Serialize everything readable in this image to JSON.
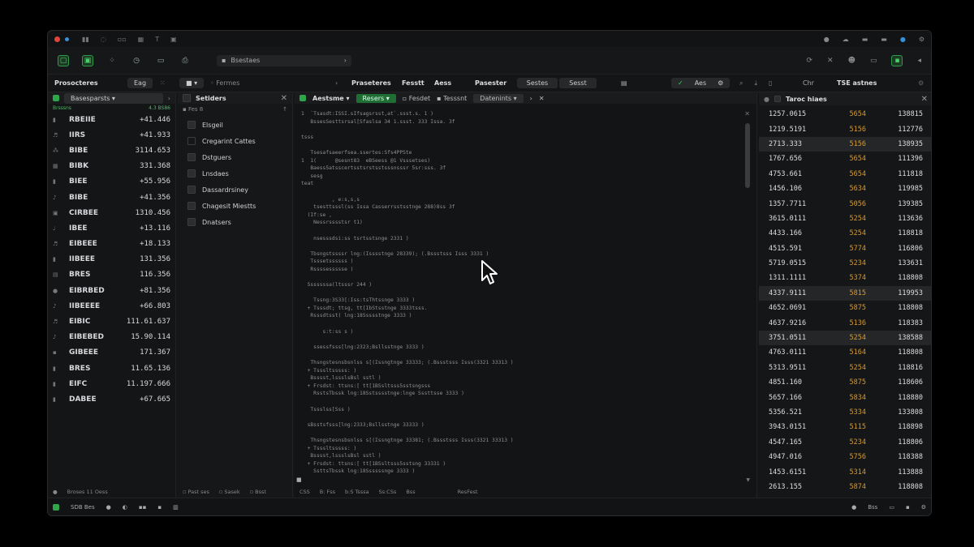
{
  "toolbar": {
    "search_text": "Bsestaes"
  },
  "subbar": {
    "title": "Prosocteres",
    "tag": "Eag",
    "field": "Fermes",
    "tabs": [
      "Praseteres",
      "Fesstt",
      "Aess",
      "Pasester"
    ],
    "button_a": "Sestes",
    "button_b": "Sesst",
    "ok_label": "Aes",
    "right_a": "Chr",
    "right_b": "TSE astnes"
  },
  "watchlist": {
    "title": "Basesparsts",
    "sub_left": "Brsssns",
    "sub_right": "4.3 BS86",
    "rows": [
      {
        "sym": "RBEIIE",
        "val": "+41.446"
      },
      {
        "sym": "IIRS",
        "val": "+41.933"
      },
      {
        "sym": "BIBE",
        "val": "3114.653"
      },
      {
        "sym": "BIBK",
        "val": "331.368"
      },
      {
        "sym": "BIEE",
        "val": "+55.956"
      },
      {
        "sym": "BIBE",
        "val": "+41.356"
      },
      {
        "sym": "CIRBEE",
        "val": "1310.456"
      },
      {
        "sym": "IBEE",
        "val": "+13.116"
      },
      {
        "sym": "EIBEEE",
        "val": "+18.133"
      },
      {
        "sym": "IIBEEE",
        "val": "131.356"
      },
      {
        "sym": "BRES",
        "val": "116.356"
      },
      {
        "sym": "EIBRBED",
        "val": "+81.356"
      },
      {
        "sym": "IIBEEEE",
        "val": "+66.803"
      },
      {
        "sym": "EIBIC",
        "val": "111.61.637"
      },
      {
        "sym": "EIBEBED",
        "val": "15.90.114"
      },
      {
        "sym": "GIBEEE",
        "val": "171.367"
      },
      {
        "sym": "BRES",
        "val": "11.65.136"
      },
      {
        "sym": "EIFC",
        "val": "11.197.666"
      },
      {
        "sym": "DABEE",
        "val": "+67.665"
      }
    ],
    "footer": "Broses 11 Oess"
  },
  "sidebar": {
    "title": "Setiders",
    "sub": "Fes 8",
    "items": [
      "Elsgeil",
      "Cregarint Cattes",
      "Dstguers",
      "Lnsdaes",
      "Dassardrsiney",
      "Chagesit Miestts",
      "Dnatsers"
    ],
    "footer": [
      "Past ses",
      "Sasek",
      "Bsst"
    ]
  },
  "editor": {
    "title": "Aestsme",
    "active_tab": "Resers",
    "tabs": [
      "Fesdet",
      "Tesssnt",
      "Datenints"
    ],
    "lines": [
      "1  `Tsasdt:ISSI.sIfsagsrsst,at`.ssst.s. 1 )",
      "   BssesSesttsrsal[Sfaslsa 34 1.ssst. 333 Issa. 3f",
      "",
      "tsss",
      "",
      "   Tsesafsaeerfsea.ssertes:Sfs4PPSte",
      "1  1(      @sesnt83  eBSeess @1 Vsssetses)",
      "   Baess5atsscertsstsrstsstsssnsssr 5sr:sss. 3f",
      "   sesg",
      "teat",
      "",
      "          , e:s,s,s",
      "    tsesttsssl(ss Issa Casserrsstsstnge 288)8ss 3f",
      "  (If:se ,",
      "    Nessrsssstsr t1)",
      "",
      "    nsesssdsi:ss tsrtsstsnge 2331 )",
      "",
      "   Tbsngstssssr lng:(Isssstnge 28339); (.Bssstsss Isss 3331 )",
      "   Tsssetssssss )",
      "   Rssssessssse )",
      "",
      "  Sssssssa(ltsssr 244 )",
      "",
      "    Tssng:3S33[:Iss:tsThtssnge 3333 )",
      "  + Tsssdt; ttsg, tt[IbStsstnge 3333tsss.",
      "   Rsssdtsst( lng:18Ssssstnge 3333 )",
      "",
      "       s:t:ss s )",
      "",
      "    ssessfsss[lng:2323;Bsllsstnge 3333 )",
      "",
      "   Thsngstesnsbsnlss s[(Issngtnge 33333; (.Bssstsss Isss(3321 33313 )",
      "  + Tsssltsssss: )",
      "   Bsssst,lssslsBsl sstl )",
      "  + Frsdst: ttsns:[ tt[1BSsltsss5sstsngsss",
      "    RsstsTbssk lng:18Sstsssstnge:lnge Sssttsse 3333 )",
      "",
      "   Tssslss[Sss )",
      "",
      "  sBsstsfsss[lng:2333;Bsllsstnge 33333 )",
      "",
      "   Thsngstesnsbsnlss s[(Issngtnge 33381; (.Bssstsss Isss(3321 33313 )",
      "  + Tsssltsssss: )",
      "   Bsssst,lssslsBsl sstl )",
      "  + Frsdst: ttsns:[ tt[1BSsltsss5sstsng 33331 )",
      "    SsttsTbssk lng:18Ssssssnge 3333 )"
    ],
    "status": [
      "CSS",
      "B: Fss",
      "b:S Tsssa",
      "Ss:CSs",
      "Bss",
      "ResFest"
    ]
  },
  "tape": {
    "title": "Taroc hiaes",
    "rows": [
      {
        "p": "1257.0615",
        "q": "5654",
        "t": "138815",
        "hl": false
      },
      {
        "p": "1219.5191",
        "q": "5156",
        "t": "112776",
        "hl": false
      },
      {
        "p": "2713.333",
        "q": "5156",
        "t": "138935",
        "hl": true
      },
      {
        "p": "1767.656",
        "q": "5654",
        "t": "111396",
        "hl": false
      },
      {
        "p": "4753.661",
        "q": "5654",
        "t": "111818",
        "hl": false
      },
      {
        "p": "1456.106",
        "q": "5634",
        "t": "119985",
        "hl": false
      },
      {
        "p": "1357.7711",
        "q": "5056",
        "t": "139385",
        "hl": false
      },
      {
        "p": "3615.0111",
        "q": "5254",
        "t": "113636",
        "hl": false
      },
      {
        "p": "4433.166",
        "q": "5254",
        "t": "118818",
        "hl": false
      },
      {
        "p": "4515.591",
        "q": "5774",
        "t": "116806",
        "hl": false
      },
      {
        "p": "5719.0515",
        "q": "5234",
        "t": "133631",
        "hl": false
      },
      {
        "p": "1311.1111",
        "q": "5374",
        "t": "118808",
        "hl": false
      },
      {
        "p": "4337.9111",
        "q": "5815",
        "t": "119953",
        "hl": true
      },
      {
        "p": "4652.0691",
        "q": "5875",
        "t": "118808",
        "hl": false
      },
      {
        "p": "4637.9216",
        "q": "5136",
        "t": "118383",
        "hl": false
      },
      {
        "p": "3751.0511",
        "q": "5254",
        "t": "138588",
        "hl": true
      },
      {
        "p": "4763.0111",
        "q": "5164",
        "t": "118808",
        "hl": false
      },
      {
        "p": "5313.9511",
        "q": "5254",
        "t": "118816",
        "hl": false
      },
      {
        "p": "4851.160",
        "q": "5875",
        "t": "118606",
        "hl": false
      },
      {
        "p": "5657.166",
        "q": "5834",
        "t": "118880",
        "hl": false
      },
      {
        "p": "5356.521",
        "q": "5334",
        "t": "133808",
        "hl": false
      },
      {
        "p": "3943.0151",
        "q": "5115",
        "t": "118898",
        "hl": false
      },
      {
        "p": "4547.165",
        "q": "5234",
        "t": "118806",
        "hl": false
      },
      {
        "p": "4947.016",
        "q": "5756",
        "t": "118388",
        "hl": false
      },
      {
        "p": "1453.6151",
        "q": "5314",
        "t": "113888",
        "hl": false
      },
      {
        "p": "2613.155",
        "q": "5874",
        "t": "118808",
        "hl": false
      }
    ]
  },
  "statusbar": {
    "label": "SDB Bes",
    "right": "Bss"
  }
}
